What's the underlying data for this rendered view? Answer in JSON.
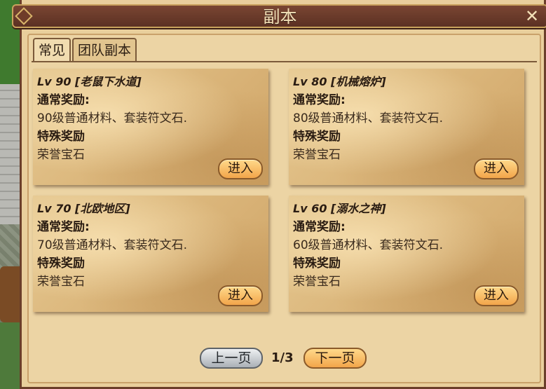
{
  "window": {
    "title": "副本"
  },
  "tabs": [
    {
      "label": "常见",
      "active": true
    },
    {
      "label": "团队副本",
      "active": false
    }
  ],
  "dungeons": [
    {
      "level": "Lv 90",
      "name": "[老鼠下水道]",
      "normal_label": "通常奖励:",
      "normal_reward": "90级普通材料、套装符文石.",
      "special_label": "特殊奖励",
      "special_reward": "荣誉宝石",
      "enter_label": "进入"
    },
    {
      "level": "Lv 80",
      "name": "[机械熔炉]",
      "normal_label": "通常奖励:",
      "normal_reward": "80级普通材料、套装符文石.",
      "special_label": "特殊奖励",
      "special_reward": "荣誉宝石",
      "enter_label": "进入"
    },
    {
      "level": "Lv 70",
      "name": "[北欧地区]",
      "normal_label": "通常奖励:",
      "normal_reward": "70级普通材料、套装符文石.",
      "special_label": "特殊奖励",
      "special_reward": "荣誉宝石",
      "enter_label": "进入"
    },
    {
      "level": "Lv 60",
      "name": "[溺水之神]",
      "normal_label": "通常奖励:",
      "normal_reward": "60级普通材料、套装符文石.",
      "special_label": "特殊奖励",
      "special_reward": "荣誉宝石",
      "enter_label": "进入"
    }
  ],
  "pager": {
    "prev_label": "上一页",
    "page": "1/3",
    "next_label": "下一页"
  },
  "icons": {
    "close": "close-icon",
    "corner": "diamond-emblem-icon"
  },
  "colors": {
    "title_bar": "#5b3023",
    "panel": "#ecd4a4",
    "button_orange": "#f2a54a"
  }
}
